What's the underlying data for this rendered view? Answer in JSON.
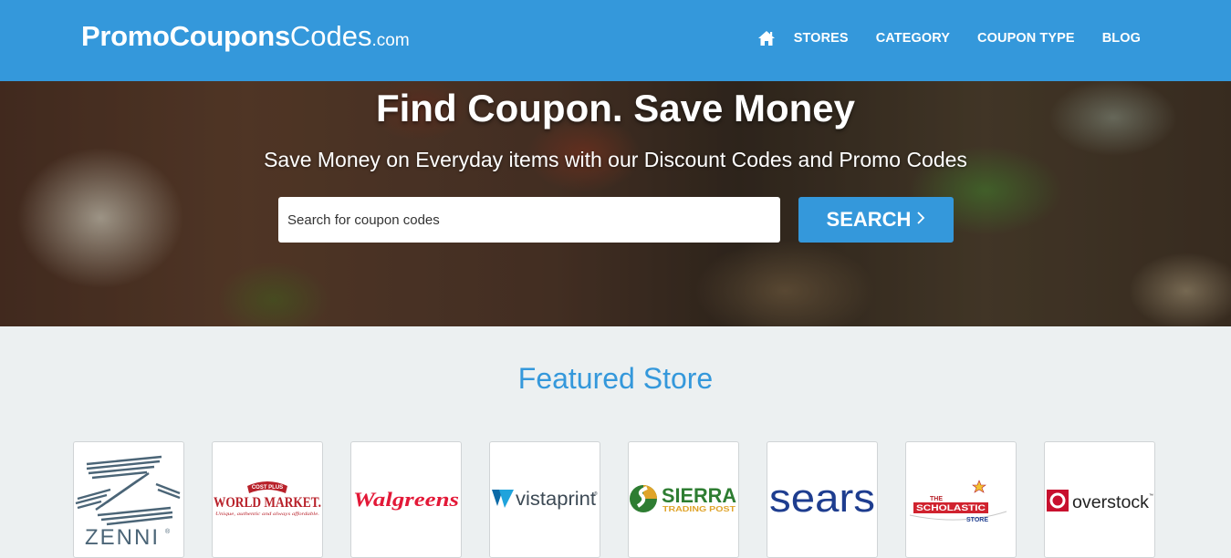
{
  "header": {
    "logo": {
      "part1": "PromoCoupons",
      "part2": "Codes",
      "part3": ".com"
    },
    "nav": [
      {
        "label": "STORES"
      },
      {
        "label": "CATEGORY"
      },
      {
        "label": "COUPON TYPE"
      },
      {
        "label": "BLOG"
      }
    ],
    "home_icon": "home-icon"
  },
  "hero": {
    "title": "Find Coupon. Save Money",
    "subtitle": "Save Money on Everyday items with our Discount Codes and Promo Codes",
    "search": {
      "placeholder": "Search for coupon codes",
      "value": ""
    },
    "search_button": "SEARCH",
    "search_button_icon": "chevron-right-icon"
  },
  "featured": {
    "title": "Featured Store",
    "stores": [
      {
        "name": "Zenni",
        "logo_text": "ZENNI",
        "mark": "®"
      },
      {
        "name": "World Market",
        "logo_text": "WORLD MARKET.",
        "tagline_top": "COST PLUS",
        "tagline": "Unique, authentic and always affordable."
      },
      {
        "name": "Walgreens",
        "logo_text": "Walgreens"
      },
      {
        "name": "Vistaprint",
        "logo_text": "vistaprint",
        "mark": "®"
      },
      {
        "name": "Sierra Trading Post",
        "logo_text": "SIERRA",
        "tagline": "TRADING POST"
      },
      {
        "name": "Sears",
        "logo_text": "sears"
      },
      {
        "name": "The Scholastic Store",
        "logo_top": "THE",
        "logo_text": "SCHOLASTIC",
        "tagline": "STORE"
      },
      {
        "name": "Overstock",
        "logo_text": "overstock",
        "mark": "™"
      }
    ]
  },
  "colors": {
    "brand_blue": "#3498db",
    "page_bg": "#ecf0f1",
    "walgreens_red": "#e31837",
    "sears_blue": "#1e3d8f",
    "world_market_red": "#b8212a",
    "sierra_green": "#2e7d32",
    "vistaprint_blue": "#0b6aa7",
    "overstock_red": "#c8102e",
    "zenni_gray": "#4b5563"
  }
}
